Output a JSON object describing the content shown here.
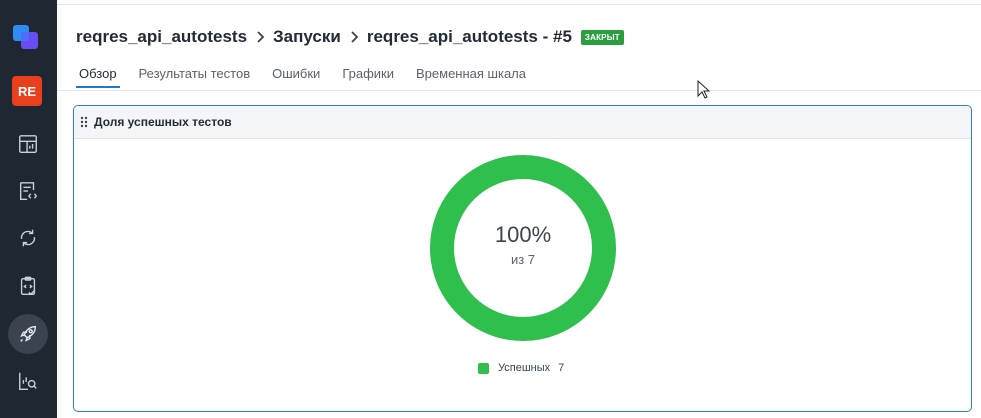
{
  "sidebar": {
    "project_initials": "RE",
    "items": [
      {
        "icon": "dashboard-icon"
      },
      {
        "icon": "test-cases-icon"
      },
      {
        "icon": "sync-icon"
      },
      {
        "icon": "clipboard-check-icon"
      },
      {
        "icon": "rocket-launches-icon",
        "active": true
      },
      {
        "icon": "analytics-search-icon"
      }
    ]
  },
  "header": {
    "breadcrumb": [
      "reqres_api_autotests",
      "Запуски",
      "reqres_api_autotests - #5"
    ],
    "status": "ЗАКРЫТ"
  },
  "tabs": [
    {
      "label": "Обзор",
      "active": true
    },
    {
      "label": "Результаты тестов"
    },
    {
      "label": "Ошибки"
    },
    {
      "label": "Графики"
    },
    {
      "label": "Временная шкала"
    }
  ],
  "widget": {
    "title": "Доля успешных тестов",
    "percent_text": "100%",
    "total_text": "из 7",
    "legend_label": "Успешных",
    "legend_count": "7"
  },
  "colors": {
    "success": "#2fbf4d",
    "accent": "#1b78d9",
    "badge": "#2c9e3f",
    "project_badge": "#e8401c",
    "sidebar_bg": "#1f2733"
  },
  "chart_data": {
    "type": "pie",
    "categories": [
      "Успешных"
    ],
    "values": [
      7
    ],
    "title": "Доля успешных тестов"
  }
}
